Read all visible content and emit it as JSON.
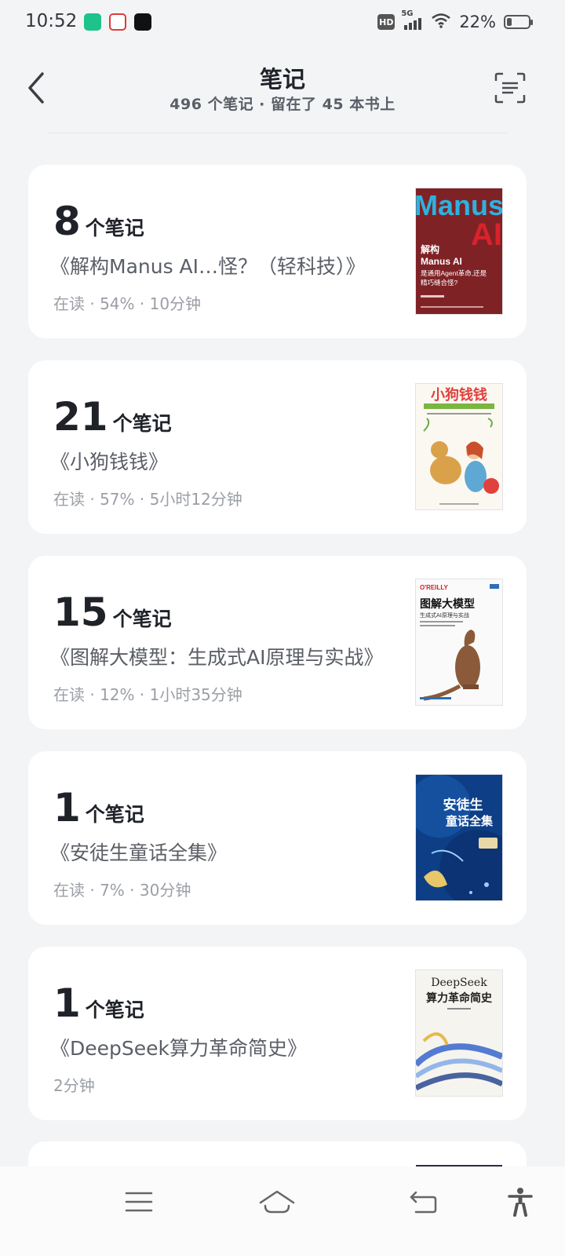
{
  "status_bar": {
    "time": "10:52",
    "network": "5G",
    "hd_label": "HD",
    "battery_percent": "22%",
    "battery_level": 0.22
  },
  "header": {
    "title": "笔记",
    "subtitle": "496 个笔记 · 留在了 45 本书上"
  },
  "cards": [
    {
      "count": "8",
      "unit": "个笔记",
      "title": "《解构Manus AI…怪？（轻科技）》",
      "meta": "在读 · 54% · 10分钟",
      "cover": "manus"
    },
    {
      "count": "21",
      "unit": "个笔记",
      "title": "《小狗钱钱》",
      "meta": "在读 · 57% · 5小时12分钟",
      "cover": "dog"
    },
    {
      "count": "15",
      "unit": "个笔记",
      "title": "《图解大模型：生成式AI原理与实战》",
      "meta": "在读 · 12% · 1小时35分钟",
      "cover": "llm"
    },
    {
      "count": "1",
      "unit": "个笔记",
      "title": "《安徒生童话全集》",
      "meta": "在读 · 7% · 30分钟",
      "cover": "andersen"
    },
    {
      "count": "1",
      "unit": "个笔记",
      "title": "《DeepSeek算力革命简史》",
      "meta": "2分钟",
      "cover": "deepseek"
    }
  ],
  "covers": {
    "manus": {
      "big1": "Manus",
      "big2": "AI",
      "line1": "解构",
      "line2": "Manus AI",
      "line3": "是通用Agent革命,还是",
      "line4": "精巧缝合怪?"
    },
    "dog": {
      "title": "小狗钱钱"
    },
    "llm": {
      "publisher": "O'REILLY",
      "title": "图解大模型",
      "subtitle": "生成式AI原理与实战"
    },
    "andersen": {
      "title1": "安徒生",
      "title2": "童话全集"
    },
    "deepseek": {
      "title1": "DeepSeek",
      "title2": "算力革命简史"
    }
  },
  "icons": {
    "back": "chevron-left-icon",
    "scan": "scan-icon",
    "nav_menu": "menu-icon",
    "nav_home": "home-icon",
    "nav_back": "back-arrow-icon",
    "nav_accessibility": "accessibility-icon"
  }
}
